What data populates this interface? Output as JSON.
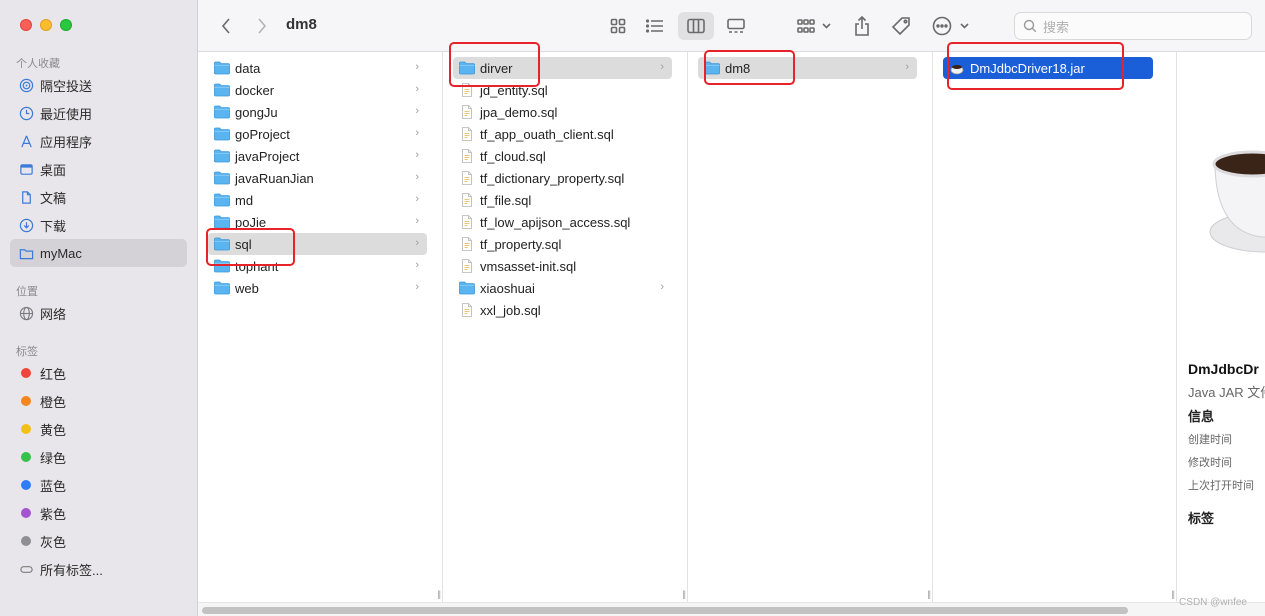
{
  "window": {
    "title": "dm8"
  },
  "sidebar": {
    "favorites_label": "个人收藏",
    "favorites": [
      {
        "label": "隔空投送",
        "icon": "airdrop-icon"
      },
      {
        "label": "最近使用",
        "icon": "clock-icon"
      },
      {
        "label": "应用程序",
        "icon": "applications-icon"
      },
      {
        "label": "桌面",
        "icon": "desktop-icon"
      },
      {
        "label": "文稿",
        "icon": "document-icon"
      },
      {
        "label": "下载",
        "icon": "download-icon"
      },
      {
        "label": "myMac",
        "icon": "folder-icon",
        "selected": true
      }
    ],
    "locations_label": "位置",
    "locations": [
      {
        "label": "网络",
        "icon": "network-icon"
      }
    ],
    "tags_label": "标签",
    "tags": [
      {
        "label": "红色",
        "color": "#f0453a"
      },
      {
        "label": "橙色",
        "color": "#f5861f"
      },
      {
        "label": "黄色",
        "color": "#f3c018"
      },
      {
        "label": "绿色",
        "color": "#35c14a"
      },
      {
        "label": "蓝色",
        "color": "#2e7cf6"
      },
      {
        "label": "紫色",
        "color": "#a453d1"
      },
      {
        "label": "灰色",
        "color": "#8e8e93"
      }
    ],
    "all_tags": "所有标签..."
  },
  "toolbar": {
    "search_placeholder": "搜索"
  },
  "columns": [
    {
      "items": [
        {
          "name": "data",
          "type": "folder"
        },
        {
          "name": "docker",
          "type": "folder"
        },
        {
          "name": "gongJu",
          "type": "folder"
        },
        {
          "name": "goProject",
          "type": "folder"
        },
        {
          "name": "javaProject",
          "type": "folder"
        },
        {
          "name": "javaRuanJian",
          "type": "folder"
        },
        {
          "name": "md",
          "type": "folder"
        },
        {
          "name": "poJie",
          "type": "folder"
        },
        {
          "name": "sql",
          "type": "folder",
          "selected": "gray"
        },
        {
          "name": "tophant",
          "type": "folder"
        },
        {
          "name": "web",
          "type": "folder"
        }
      ]
    },
    {
      "items": [
        {
          "name": "dirver",
          "type": "folder",
          "selected": "gray"
        },
        {
          "name": "jd_entity.sql",
          "type": "file"
        },
        {
          "name": "jpa_demo.sql",
          "type": "file"
        },
        {
          "name": "tf_app_ouath_client.sql",
          "type": "file"
        },
        {
          "name": "tf_cloud.sql",
          "type": "file"
        },
        {
          "name": "tf_dictionary_property.sql",
          "type": "file"
        },
        {
          "name": "tf_file.sql",
          "type": "file"
        },
        {
          "name": "tf_low_apijson_access.sql",
          "type": "file"
        },
        {
          "name": "tf_property.sql",
          "type": "file"
        },
        {
          "name": "vmsasset-init.sql",
          "type": "file"
        },
        {
          "name": "xiaoshuai",
          "type": "folder"
        },
        {
          "name": "xxl_job.sql",
          "type": "file"
        }
      ]
    },
    {
      "items": [
        {
          "name": "dm8",
          "type": "folder",
          "selected": "gray"
        }
      ]
    },
    {
      "items": [
        {
          "name": "DmJdbcDriver18.jar",
          "type": "jar",
          "selected": "blue"
        }
      ]
    }
  ],
  "preview": {
    "name": "DmJdbcDr",
    "kind": "Java JAR 文件",
    "info_heading": "信息",
    "created_label": "创建时间",
    "modified_label": "修改时间",
    "last_opened_label": "上次打开时间",
    "tags_heading": "标签"
  },
  "watermark": "CSDN @wnfee"
}
